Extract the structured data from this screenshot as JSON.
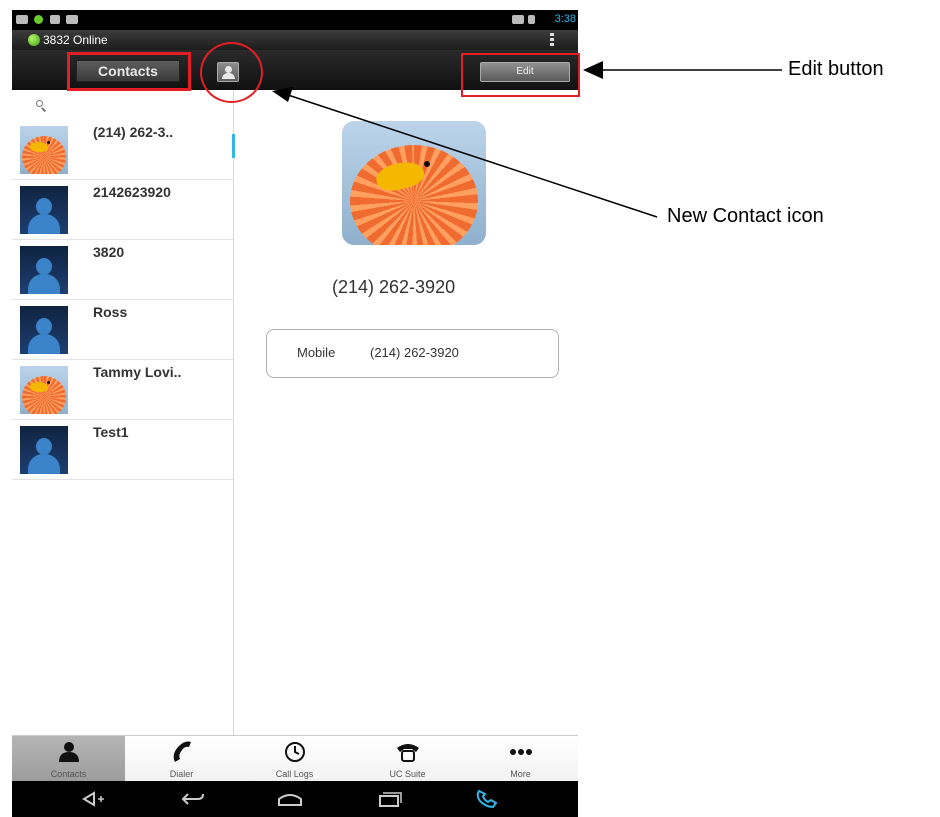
{
  "status_bar": {
    "time": "3:38"
  },
  "online_bar": {
    "status_text": "3832 Online"
  },
  "action_bar": {
    "title_tab": "Contacts",
    "edit_label": "Edit"
  },
  "contact_list": {
    "items": [
      {
        "name": "(214) 262-3..",
        "avatar": "bird-photo"
      },
      {
        "name": "2142623920",
        "avatar": "generic-person-icon"
      },
      {
        "name": "3820",
        "avatar": "generic-person-icon"
      },
      {
        "name": "Ross",
        "avatar": "generic-person-icon"
      },
      {
        "name": "Tammy Lovi..",
        "avatar": "bird-photo"
      },
      {
        "name": "Test1",
        "avatar": "generic-person-icon"
      }
    ]
  },
  "detail": {
    "photo": "bird-photo",
    "number": "(214) 262-3920",
    "phone_type": "Mobile",
    "phone_number": "(214) 262-3920"
  },
  "tab_bar": {
    "tabs": [
      {
        "label": "Contacts",
        "icon": "person-icon",
        "active": true
      },
      {
        "label": "Dialer",
        "icon": "handset-icon",
        "active": false
      },
      {
        "label": "Call Logs",
        "icon": "clock-icon",
        "active": false
      },
      {
        "label": "UC Suite",
        "icon": "uc-suite-icon",
        "active": false
      },
      {
        "label": "More",
        "icon": "more-dots-icon",
        "active": false
      }
    ]
  },
  "annotations": {
    "edit_button": "Edit button",
    "new_contact_icon": "New Contact icon"
  },
  "colors": {
    "annotation_red": "#e31e24",
    "accent_blue": "#33b5e5",
    "online_green": "#3aa10f"
  }
}
